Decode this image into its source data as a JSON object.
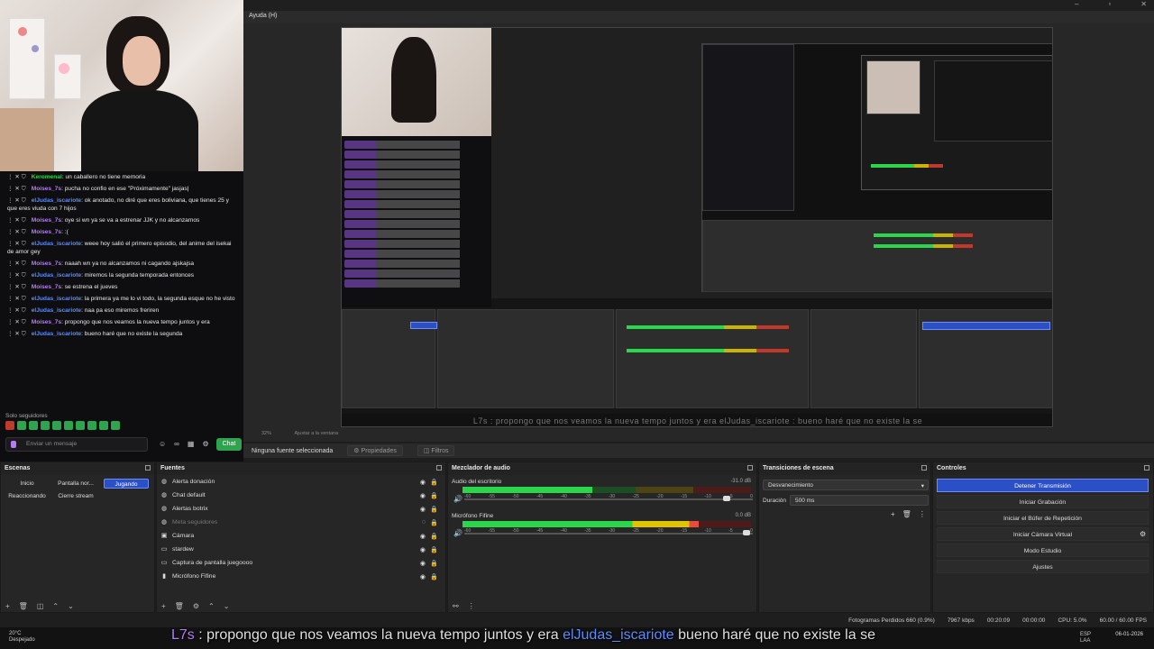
{
  "window": {
    "menu_help": "Ayuda (H)"
  },
  "chat": {
    "lines": [
      {
        "user": "Keromenal",
        "color": "green",
        "text": ": un caballero no tiene memoria"
      },
      {
        "user": "Moises_7s",
        "color": "purple",
        "text": ": pucha no confio en ese \"Próximamente\" jasjas|"
      },
      {
        "user": "elJudas_iscariote",
        "color": "blue",
        "text": ": ok anotado, no diré que eres boliviana, que tienes 25 y que eres viuda con 7 hijos"
      },
      {
        "user": "Moises_7s",
        "color": "purple",
        "text": ": oye si wn ya se va a estrenar JJK y no alcanzamos"
      },
      {
        "user": "Moises_7s",
        "color": "purple",
        "text": ": :("
      },
      {
        "user": "elJudas_iscariote",
        "color": "blue",
        "text": ": weee hoy salió el primero episodio, del anime del isekai de amor gey"
      },
      {
        "user": "Moises_7s",
        "color": "purple",
        "text": ": naaah wn ya no alcanzamos ni cagando ajskajsa"
      },
      {
        "user": "elJudas_iscariote",
        "color": "blue",
        "text": ": miremos la segunda temporada entonces"
      },
      {
        "user": "Moises_7s",
        "color": "purple",
        "text": ": se estrena el jueves"
      },
      {
        "user": "elJudas_iscariote",
        "color": "blue",
        "text": ": la primera ya me lo vi todo, la segunda esque no he visto"
      },
      {
        "user": "elJudas_iscariote",
        "color": "blue",
        "text": ": naa pa eso miremos freriren"
      },
      {
        "user": "Moises_7s",
        "color": "purple",
        "text": ": propongo que nos veamos la nueva tempo juntos y era"
      },
      {
        "user": "elJudas_iscariote",
        "color": "blue",
        "text": ": bueno haré que no existe la segunda"
      }
    ],
    "solo_seguidores": "Solo seguidores",
    "input_placeholder": "Enviar un mensaje",
    "chat_button": "Chat"
  },
  "preview": {
    "zoom": "32%",
    "fit": "Ajustar a la ventana",
    "nested_subtitle": "L7s : propongo que nos veamos la nueva tempo juntos y era elJudas_iscariote : bueno haré que no existe la se"
  },
  "context_bar": {
    "no_source": "Ninguna fuente seleccionada",
    "properties": "Propiedades",
    "filters": "Filtros"
  },
  "scenes": {
    "title": "Escenas",
    "items": [
      "Inicio",
      "Pantalla nor...",
      "Jugando",
      "Reaccionando",
      "Cierre stream"
    ],
    "active": "Jugando"
  },
  "sources": {
    "title": "Fuentes",
    "items": [
      {
        "label": "Alerta donación",
        "icon": "globe-icon",
        "glyph": "◍",
        "hidden": false
      },
      {
        "label": "Chat default",
        "icon": "globe-icon",
        "glyph": "◍",
        "hidden": false
      },
      {
        "label": "Alertas botrix",
        "icon": "globe-icon",
        "glyph": "◍",
        "hidden": false
      },
      {
        "label": "Meta seguidores",
        "icon": "globe-icon",
        "glyph": "◍",
        "hidden": true
      },
      {
        "label": "Cámara",
        "icon": "camera-icon",
        "glyph": "▣",
        "hidden": false
      },
      {
        "label": "stardew",
        "icon": "window-icon",
        "glyph": "▭",
        "hidden": false
      },
      {
        "label": "Captura de pantalla juegoooo",
        "icon": "monitor-icon",
        "glyph": "▭",
        "hidden": false
      },
      {
        "label": "Micrófono Fifine",
        "icon": "mic-icon",
        "glyph": "▮",
        "hidden": false
      }
    ]
  },
  "mixer": {
    "title": "Mezclador de audio",
    "channels": [
      {
        "name": "Audio del escritorio",
        "db": "-31.0 dB",
        "level": 0.45,
        "volume": 0.92
      },
      {
        "name": "Micrófono Fifine",
        "db": "0.0 dB",
        "level": 0.82,
        "volume": 0.99
      }
    ],
    "scale": [
      "-60",
      "-55",
      "-50",
      "-45",
      "-40",
      "-35",
      "-30",
      "-25",
      "-20",
      "-15",
      "-10",
      "-5",
      "0"
    ]
  },
  "transitions": {
    "title": "Transiciones de escena",
    "selected": "Desvanecimiento",
    "duration_label": "Duración",
    "duration_value": "500 ms"
  },
  "controls": {
    "title": "Controles",
    "buttons": [
      "Detener Transmisión",
      "Iniciar Grabación",
      "Iniciar el Búfer de Repetición",
      "Iniciar Cámara Virtual",
      "Modo Estudio",
      "Ajustes"
    ]
  },
  "status": {
    "dropped": "Fotogramas Perdidos 660 (0.9%)",
    "bitrate": "7967 kbps",
    "stream_time": "00:20:09",
    "rec_time": "00:00:00",
    "cpu": "CPU: 5.0%",
    "fps": "60.00 / 60.00 FPS"
  },
  "subtitle": {
    "user1": "L7s",
    "text1": " : propongo que nos veamos la nueva tempo juntos y era ",
    "user2": "elJudas_iscariote",
    "text2": " bueno haré que no existe la se"
  },
  "taskbar": {
    "temp": "20°C",
    "weather": "Despejado",
    "lang1": "ESP",
    "lang2": "LAA",
    "time": "",
    "date": "06-01-2026"
  },
  "colors": {
    "accent": "#2b4fc4",
    "twitch_green": "#2ea44f",
    "meter_green": "#2bd64a"
  }
}
